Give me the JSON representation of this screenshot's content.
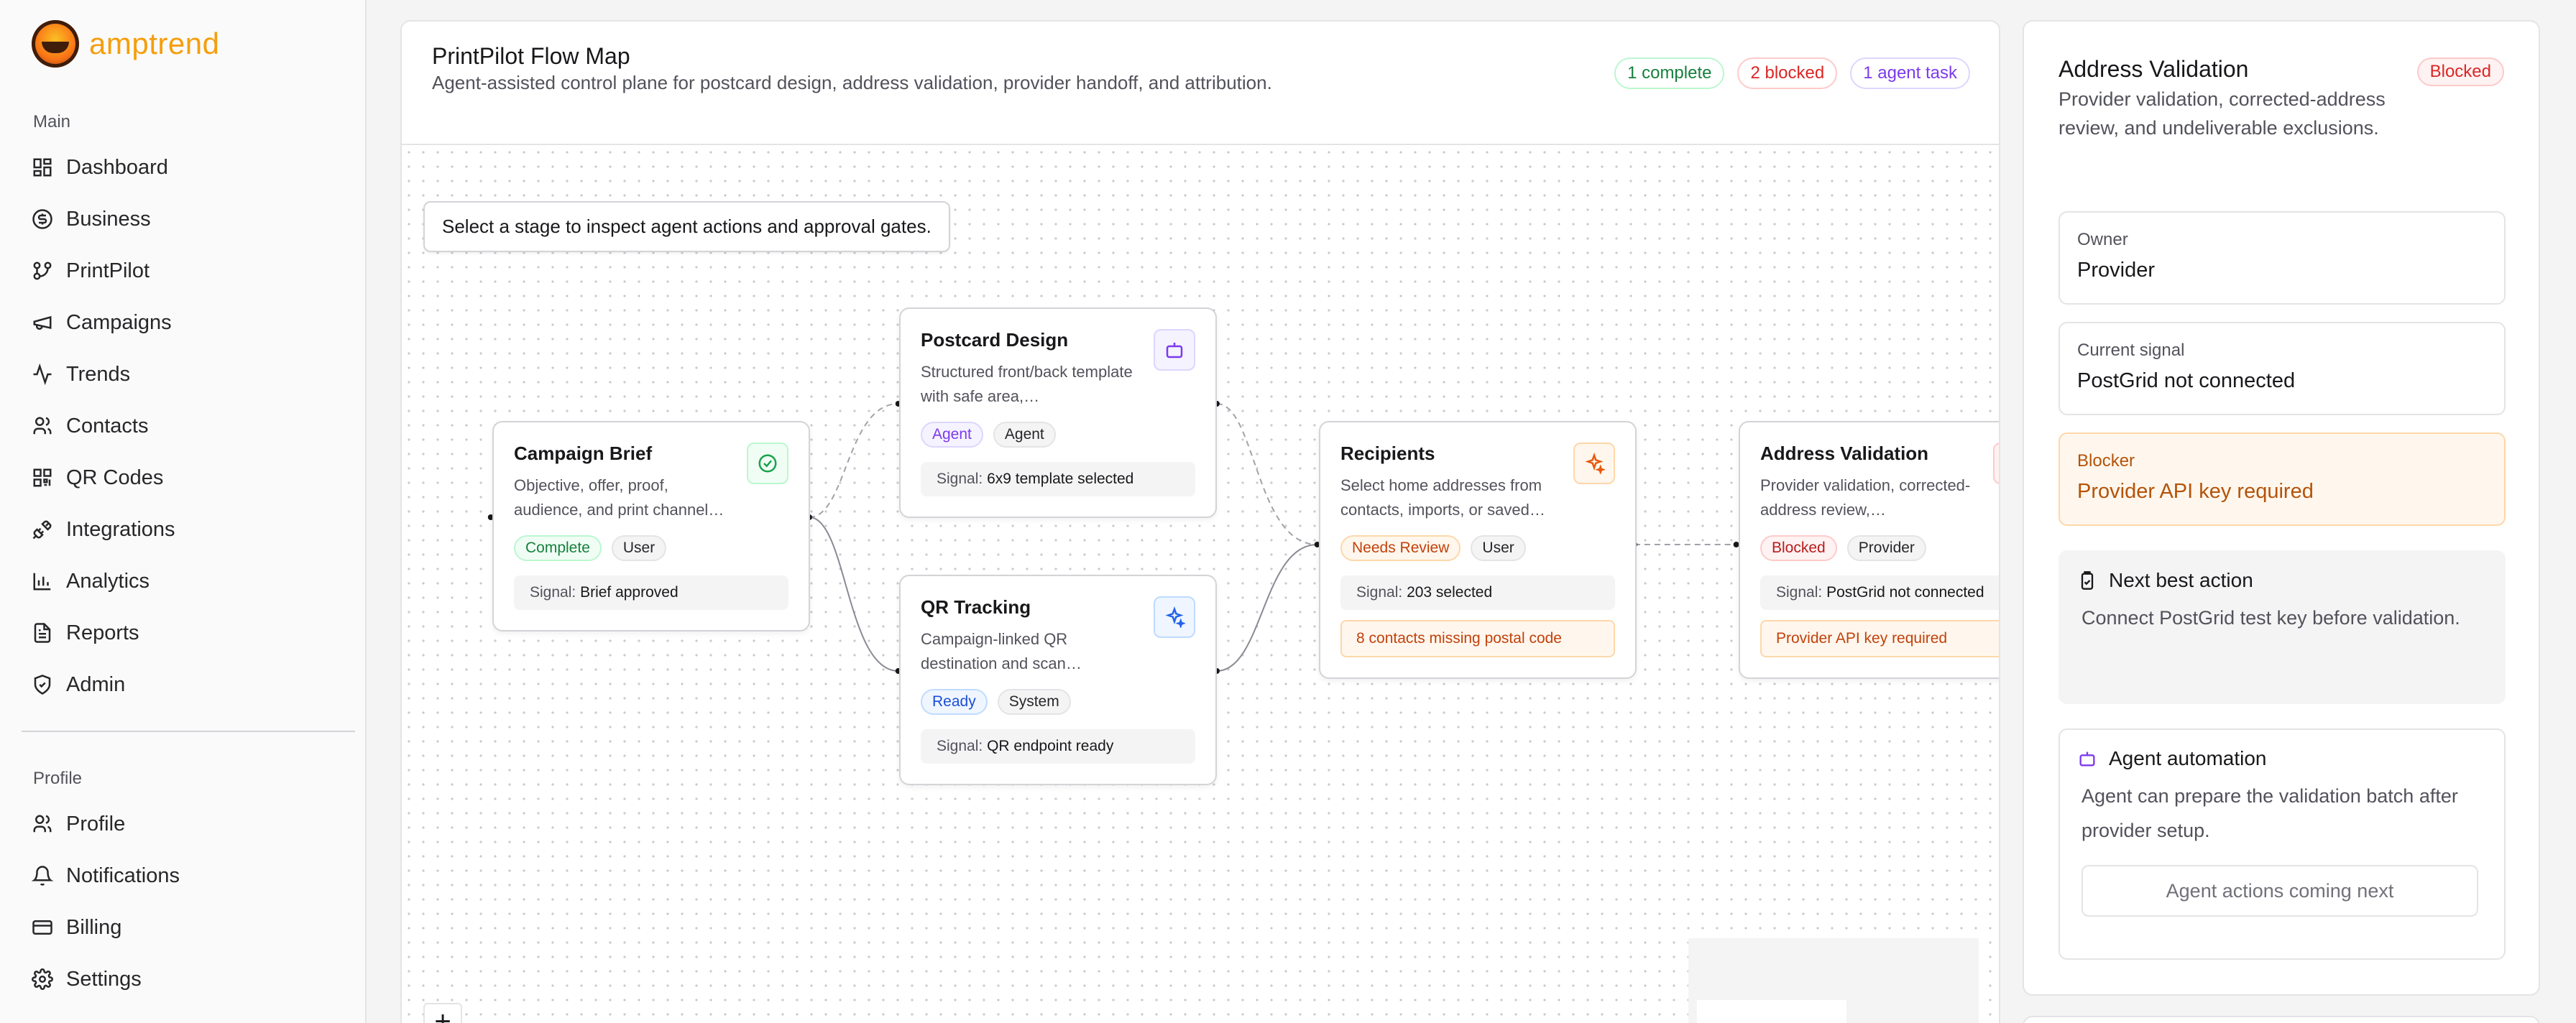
{
  "brand": {
    "name": "amptrend"
  },
  "sidebar": {
    "main_title": "Main",
    "main_items": [
      {
        "label": "Dashboard",
        "icon": "dashboard-icon"
      },
      {
        "label": "Business",
        "icon": "dollar-icon"
      },
      {
        "label": "PrintPilot",
        "icon": "flow-icon"
      },
      {
        "label": "Campaigns",
        "icon": "megaphone-icon"
      },
      {
        "label": "Trends",
        "icon": "activity-icon"
      },
      {
        "label": "Contacts",
        "icon": "users-icon"
      },
      {
        "label": "QR Codes",
        "icon": "qr-icon"
      },
      {
        "label": "Integrations",
        "icon": "plug-icon"
      },
      {
        "label": "Analytics",
        "icon": "bar-chart-icon"
      },
      {
        "label": "Reports",
        "icon": "file-text-icon"
      },
      {
        "label": "Admin",
        "icon": "shield-icon"
      }
    ],
    "profile_title": "Profile",
    "profile_items": [
      {
        "label": "Profile",
        "icon": "users-icon"
      },
      {
        "label": "Notifications",
        "icon": "bell-icon"
      },
      {
        "label": "Billing",
        "icon": "credit-card-icon"
      },
      {
        "label": "Settings",
        "icon": "gear-icon"
      }
    ]
  },
  "main": {
    "title": "PrintPilot Flow Map",
    "subtitle": "Agent-assisted control plane for postcard design, address validation, provider handoff, and attribution.",
    "badges": {
      "complete": "1 complete",
      "blocked": "2 blocked",
      "agent": "1 agent task"
    },
    "hint": "Select a stage to inspect agent actions and approval gates.",
    "plus": "+"
  },
  "nodes": {
    "brief": {
      "title": "Campaign Brief",
      "desc": "Objective, offer, proof, audience, and print channel…",
      "status": "Complete",
      "owner": "User",
      "signal_label": "Signal:",
      "signal": "Brief approved",
      "icon": "check-circle-icon"
    },
    "design": {
      "title": "Postcard Design",
      "desc": "Structured front/back template with safe area,…",
      "status": "Agent",
      "owner": "Agent",
      "signal_label": "Signal:",
      "signal": "6x9 template selected",
      "icon": "bot-icon"
    },
    "qr": {
      "title": "QR Tracking",
      "desc": "Campaign-linked QR destination and scan…",
      "status": "Ready",
      "owner": "System",
      "signal_label": "Signal:",
      "signal": "QR endpoint ready",
      "icon": "sparkles-icon"
    },
    "recipients": {
      "title": "Recipients",
      "desc": "Select home addresses from contacts, imports, or saved…",
      "status": "Needs Review",
      "owner": "User",
      "signal_label": "Signal:",
      "signal": "203 selected",
      "warning": "8 contacts missing postal code",
      "icon": "sparkles-icon"
    },
    "address": {
      "title": "Address Validation",
      "desc": "Provider validation, corrected-address review,…",
      "status": "Blocked",
      "owner": "Provider",
      "signal_label": "Signal:",
      "signal": "PostGrid not connected",
      "warning": "Provider API key required",
      "icon": "alert-icon"
    }
  },
  "detail": {
    "title": "Address Validation",
    "status": "Blocked",
    "desc": "Provider validation, corrected-address review, and undeliverable exclusions.",
    "owner_label": "Owner",
    "owner": "Provider",
    "signal_label": "Current signal",
    "signal": "PostGrid not connected",
    "blocker_label": "Blocker",
    "blocker": "Provider API key required",
    "next_title": "Next best action",
    "next_text": "Connect PostGrid test key before validation.",
    "agent_title": "Agent automation",
    "agent_text": "Agent can prepare the validation batch after provider setup.",
    "agent_button": "Agent actions coming next"
  }
}
